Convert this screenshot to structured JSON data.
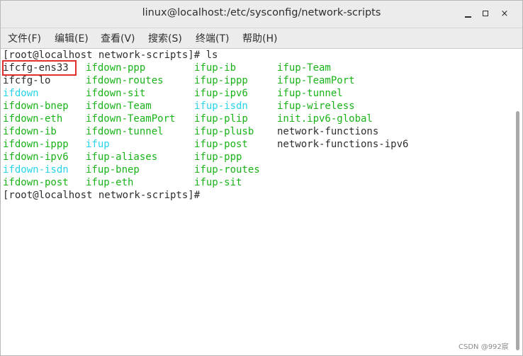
{
  "window": {
    "title": "linux@localhost:/etc/sysconfig/network-scripts",
    "minimize_label": "minimize",
    "maximize_label": "maximize",
    "close_label": "×"
  },
  "menu": {
    "file": "文件(F)",
    "edit": "编辑(E)",
    "view": "查看(V)",
    "search": "搜索(S)",
    "terminal": "终端(T)",
    "help": "帮助(H)"
  },
  "terminal": {
    "prompt_1": "[root@localhost network-scripts]# ls",
    "prompt_2": "[root@localhost network-scripts]#",
    "files": [
      [
        "ifcfg-ens33",
        "ifdown-ppp",
        "ifup-ib",
        "ifup-Team"
      ],
      [
        "ifcfg-lo",
        "ifdown-routes",
        "ifup-ippp",
        "ifup-TeamPort"
      ],
      [
        "ifdown",
        "ifdown-sit",
        "ifup-ipv6",
        "ifup-tunnel"
      ],
      [
        "ifdown-bnep",
        "ifdown-Team",
        "ifup-isdn",
        "ifup-wireless"
      ],
      [
        "ifdown-eth",
        "ifdown-TeamPort",
        "ifup-plip",
        "init.ipv6-global"
      ],
      [
        "ifdown-ib",
        "ifdown-tunnel",
        "ifup-plusb",
        "network-functions"
      ],
      [
        "ifdown-ippp",
        "ifup",
        "ifup-post",
        "network-functions-ipv6"
      ],
      [
        "ifdown-ipv6",
        "ifup-aliases",
        "ifup-ppp",
        ""
      ],
      [
        "ifdown-isdn",
        "ifup-bnep",
        "ifup-routes",
        ""
      ],
      [
        "ifdown-post",
        "ifup-eth",
        "ifup-sit",
        ""
      ]
    ],
    "file_types": [
      [
        "plain",
        "exe",
        "exe",
        "exe"
      ],
      [
        "plain",
        "exe",
        "exe",
        "exe"
      ],
      [
        "link",
        "exe",
        "exe",
        "exe"
      ],
      [
        "exe",
        "exe",
        "link",
        "exe"
      ],
      [
        "exe",
        "exe",
        "exe",
        "exe"
      ],
      [
        "exe",
        "exe",
        "exe",
        "plain"
      ],
      [
        "exe",
        "link",
        "exe",
        "plain"
      ],
      [
        "exe",
        "exe",
        "exe",
        ""
      ],
      [
        "link",
        "exe",
        "exe",
        ""
      ],
      [
        "exe",
        "exe",
        "exe",
        ""
      ]
    ]
  },
  "colors": {
    "executable": "#19b319",
    "symlink": "#27d4e8",
    "plain": "#2e2e2e",
    "highlight": "#e0302e"
  },
  "watermark": "CSDN @992宸"
}
